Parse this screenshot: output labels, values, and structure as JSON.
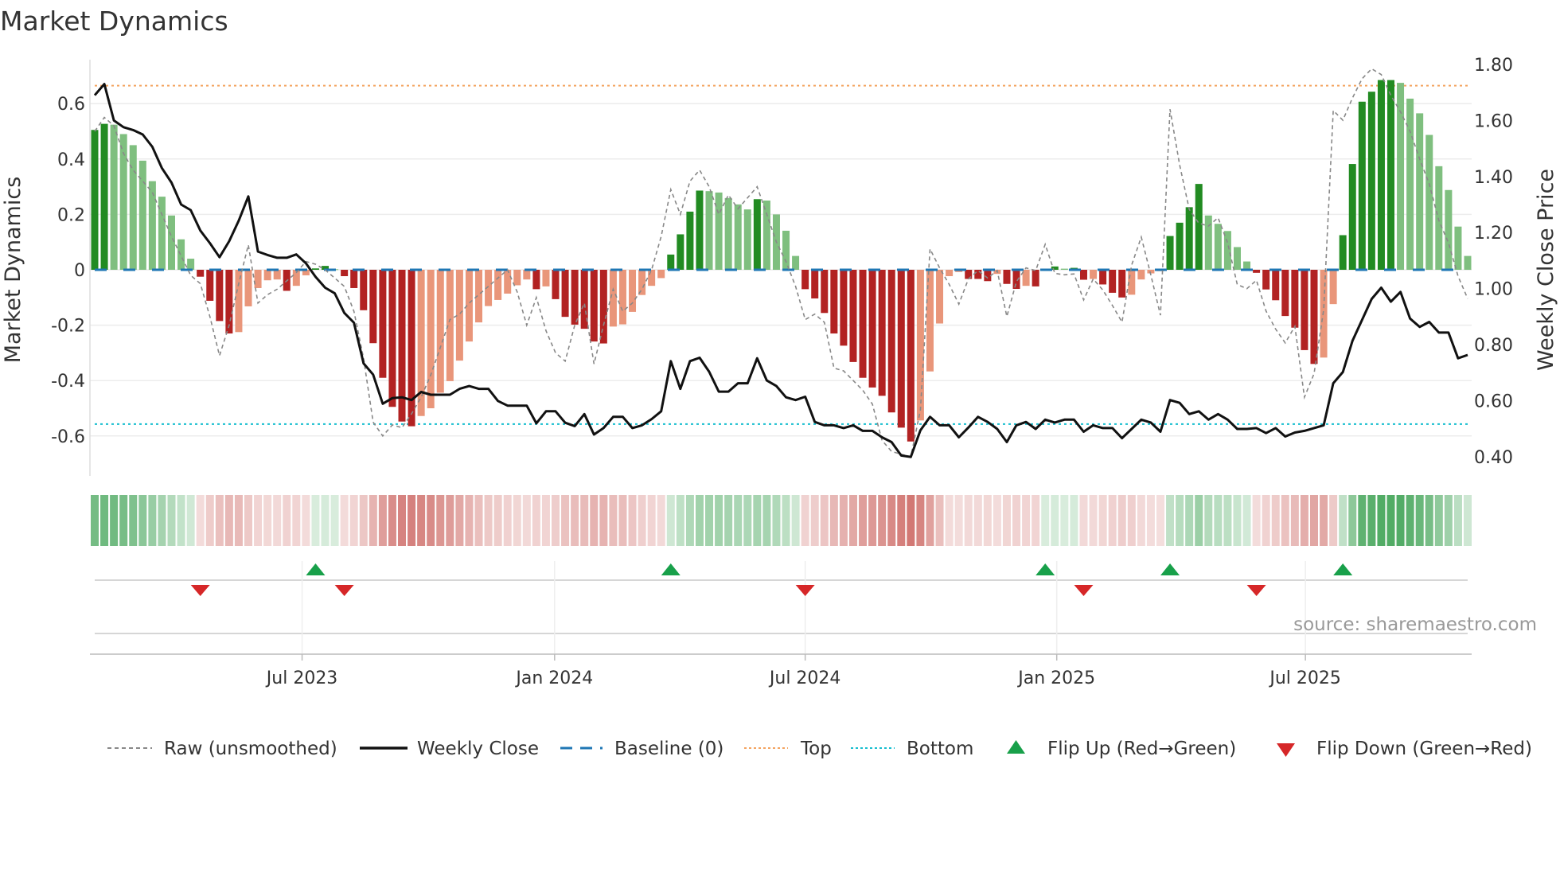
{
  "title": "Market Dynamics",
  "source": "source: sharemaestro.com",
  "colors": {
    "strong_up": "#228b22",
    "weak_up": "#7fbf7f",
    "strong_down": "#b22222",
    "weak_down": "#e9967a",
    "price": "#111111",
    "raw": "#888888",
    "baseline": "#1f77b4",
    "top": "#f4a460",
    "bottom": "#17becf",
    "flip_up": "#18a04a",
    "flip_down": "#d62728"
  },
  "chart_data": {
    "type": "bar",
    "title": "Market Dynamics",
    "ylabel": "Market Dynamics",
    "y2label": "Weekly Close Price",
    "ylim": [
      -0.75,
      0.78
    ],
    "y2lim": [
      0.37,
      1.84
    ],
    "yticks": [
      "0.6",
      "0.4",
      "0.2",
      "0",
      "-0.2",
      "-0.4",
      "-0.6"
    ],
    "ytick_values": [
      0.6,
      0.4,
      0.2,
      0,
      -0.2,
      -0.4,
      -0.6
    ],
    "y2ticks": [
      "1.80",
      "1.60",
      "1.40",
      "1.20",
      "1.00",
      "0.80",
      "0.60",
      "0.40"
    ],
    "y2tick_values": [
      1.8,
      1.6,
      1.4,
      1.2,
      1.0,
      0.8,
      0.6,
      0.4
    ],
    "xticks": [
      {
        "label": "Jul 2023",
        "week": 21.6
      },
      {
        "label": "Jan 2024",
        "week": 47.9
      },
      {
        "label": "Jul 2024",
        "week": 74.0
      },
      {
        "label": "Jan 2025",
        "week": 100.2
      },
      {
        "label": "Jul 2025",
        "week": 126.1
      }
    ],
    "top_level": 0.665,
    "bottom_level": -0.557,
    "grid": true,
    "legend_position": "bottom",
    "dynamics": [
      0.505,
      0.527,
      0.524,
      0.49,
      0.45,
      0.394,
      0.32,
      0.264,
      0.196,
      0.11,
      0.04,
      -0.025,
      -0.112,
      -0.185,
      -0.23,
      -0.225,
      -0.132,
      -0.066,
      -0.038,
      -0.035,
      -0.076,
      -0.058,
      -0.02,
      0.005,
      0.014,
      0.002,
      -0.023,
      -0.066,
      -0.146,
      -0.265,
      -0.39,
      -0.495,
      -0.548,
      -0.565,
      -0.528,
      -0.5,
      -0.444,
      -0.402,
      -0.328,
      -0.259,
      -0.19,
      -0.131,
      -0.109,
      -0.086,
      -0.056,
      -0.035,
      -0.07,
      -0.06,
      -0.106,
      -0.17,
      -0.198,
      -0.213,
      -0.259,
      -0.266,
      -0.205,
      -0.197,
      -0.152,
      -0.091,
      -0.058,
      -0.03,
      0.055,
      0.128,
      0.21,
      0.286,
      0.284,
      0.279,
      0.259,
      0.236,
      0.218,
      0.255,
      0.25,
      0.2,
      0.141,
      0.05,
      -0.07,
      -0.1035,
      -0.156,
      -0.23,
      -0.274,
      -0.333,
      -0.39,
      -0.425,
      -0.455,
      -0.515,
      -0.57,
      -0.62,
      -0.544,
      -0.367,
      -0.194,
      -0.023,
      -0.008,
      -0.033,
      -0.033,
      -0.041,
      -0.015,
      -0.051,
      -0.069,
      -0.058,
      -0.06,
      0.003,
      0.012,
      0.004,
      0.007,
      -0.036,
      -0.033,
      -0.053,
      -0.083,
      -0.1,
      -0.09,
      -0.035,
      -0.013,
      -0.005,
      0.122,
      0.17,
      0.226,
      0.31,
      0.196,
      0.166,
      0.14,
      0.082,
      0.03,
      -0.011,
      -0.071,
      -0.11,
      -0.167,
      -0.209,
      -0.29,
      -0.34,
      -0.317,
      -0.124,
      0.125,
      0.382,
      0.607,
      0.643,
      0.685,
      0.685,
      0.675,
      0.618,
      0.565,
      0.487,
      0.374,
      0.288,
      0.156,
      0.05
    ],
    "raw": [
      0.5,
      0.55,
      0.52,
      0.42,
      0.36,
      0.32,
      0.28,
      0.2,
      0.12,
      0.05,
      -0.02,
      -0.05,
      -0.17,
      -0.31,
      -0.2,
      -0.05,
      0.09,
      -0.12,
      -0.09,
      -0.07,
      -0.04,
      -0.01,
      0.03,
      0.02,
      0.0,
      -0.03,
      -0.06,
      -0.15,
      -0.32,
      -0.55,
      -0.6,
      -0.56,
      -0.57,
      -0.52,
      -0.46,
      -0.38,
      -0.28,
      -0.18,
      -0.16,
      -0.12,
      -0.09,
      -0.06,
      -0.03,
      0.0,
      -0.08,
      -0.2,
      -0.1,
      -0.22,
      -0.3,
      -0.33,
      -0.2,
      -0.12,
      -0.34,
      -0.2,
      -0.07,
      -0.15,
      -0.12,
      -0.07,
      0.0,
      0.12,
      0.29,
      0.2,
      0.32,
      0.36,
      0.3,
      0.2,
      0.27,
      0.22,
      0.26,
      0.3,
      0.2,
      0.1,
      0.03,
      -0.06,
      -0.18,
      -0.16,
      -0.19,
      -0.355,
      -0.365,
      -0.4,
      -0.435,
      -0.485,
      -0.616,
      -0.656,
      -0.666,
      -0.676,
      -0.506,
      0.075,
      0.007,
      -0.053,
      -0.124,
      -0.033,
      -0.003,
      -0.03,
      -0.003,
      -0.169,
      -0.043,
      0.007,
      -0.003,
      0.092,
      -0.013,
      -0.018,
      -0.015,
      -0.109,
      -0.033,
      -0.073,
      -0.129,
      -0.189,
      0.017,
      0.118,
      -0.018,
      -0.164,
      0.58,
      0.379,
      0.218,
      0.168,
      0.158,
      0.188,
      0.097,
      -0.053,
      -0.068,
      -0.038,
      -0.149,
      -0.214,
      -0.264,
      -0.204,
      -0.46,
      -0.375,
      -0.144,
      0.575,
      0.54,
      0.62,
      0.69,
      0.726,
      0.705,
      0.63,
      0.57,
      0.5,
      0.4,
      0.31,
      0.178,
      0.097,
      -0.023,
      -0.104
    ],
    "weekly_close": [
      1.69,
      1.73,
      1.6,
      1.576,
      1.566,
      1.55,
      1.506,
      1.43,
      1.378,
      1.3,
      1.28,
      1.207,
      1.162,
      1.112,
      1.169,
      1.242,
      1.329,
      1.132,
      1.12,
      1.11,
      1.11,
      1.122,
      1.09,
      1.042,
      1.003,
      0.983,
      0.913,
      0.878,
      0.733,
      0.693,
      0.589,
      0.609,
      0.612,
      0.602,
      0.631,
      0.621,
      0.621,
      0.621,
      0.642,
      0.652,
      0.642,
      0.642,
      0.599,
      0.582,
      0.582,
      0.582,
      0.519,
      0.562,
      0.562,
      0.521,
      0.509,
      0.552,
      0.479,
      0.502,
      0.542,
      0.542,
      0.502,
      0.512,
      0.534,
      0.562,
      0.741,
      0.642,
      0.741,
      0.753,
      0.703,
      0.632,
      0.632,
      0.662,
      0.662,
      0.751,
      0.672,
      0.652,
      0.612,
      0.602,
      0.614,
      0.524,
      0.512,
      0.512,
      0.502,
      0.512,
      0.492,
      0.492,
      0.469,
      0.452,
      0.404,
      0.399,
      0.494,
      0.542,
      0.512,
      0.512,
      0.469,
      0.504,
      0.542,
      0.524,
      0.499,
      0.452,
      0.512,
      0.524,
      0.499,
      0.532,
      0.522,
      0.532,
      0.532,
      0.489,
      0.512,
      0.502,
      0.502,
      0.466,
      0.499,
      0.532,
      0.522,
      0.489,
      0.602,
      0.592,
      0.552,
      0.562,
      0.532,
      0.552,
      0.532,
      0.499,
      0.499,
      0.502,
      0.484,
      0.502,
      0.472,
      0.486,
      0.492,
      0.502,
      0.512,
      0.662,
      0.702,
      0.813,
      0.888,
      0.963,
      1.003,
      0.953,
      0.988,
      0.893,
      0.863,
      0.881,
      0.843,
      0.843,
      0.751,
      0.763
    ]
  },
  "legend": [
    {
      "label": "Raw (unsmoothed)"
    },
    {
      "label": "Weekly Close"
    },
    {
      "label": "Baseline (0)"
    },
    {
      "label": "Top"
    },
    {
      "label": "Bottom"
    },
    {
      "label": "Flip Up (Red→Green)"
    },
    {
      "label": "Flip Down (Green→Red)"
    }
  ]
}
